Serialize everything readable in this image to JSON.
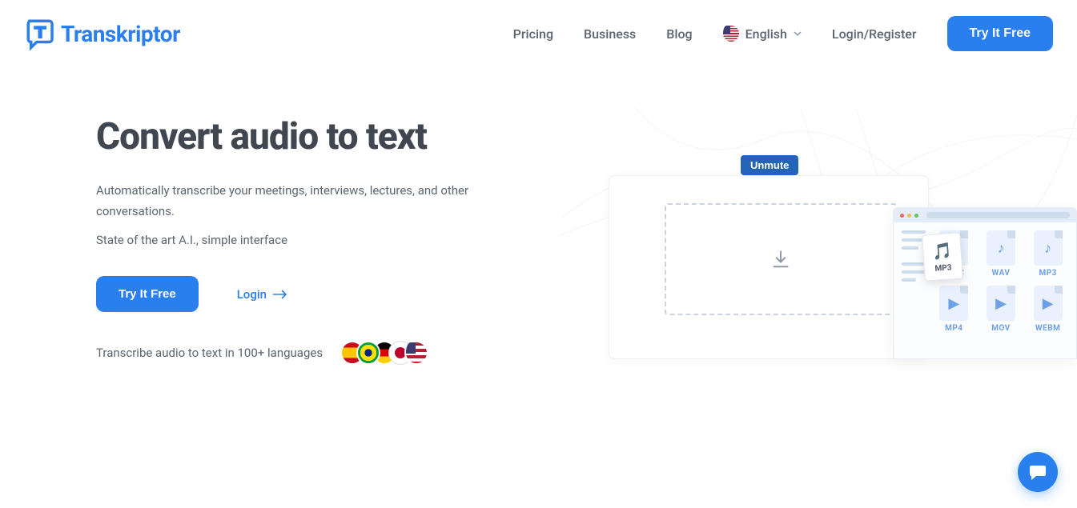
{
  "brand": {
    "name": "Transkriptor"
  },
  "nav": {
    "pricing": "Pricing",
    "business": "Business",
    "blog": "Blog",
    "language_label": "English",
    "login_register": "Login/Register",
    "try_free": "Try It Free"
  },
  "hero": {
    "title": "Convert audio to text",
    "description": "Automatically transcribe your meetings, interviews, lectures, and other conversations.",
    "subline": "State of the art A.I., simple interface",
    "try_free": "Try It Free",
    "login": "Login",
    "lang_note": "Transcribe audio to text in 100+ languages"
  },
  "illustration": {
    "unmute": "Unmute",
    "files": [
      "FLAC",
      "WAV",
      "MP3",
      "MP4",
      "MOV",
      "WEBM"
    ],
    "dragged_file": "MP3"
  }
}
